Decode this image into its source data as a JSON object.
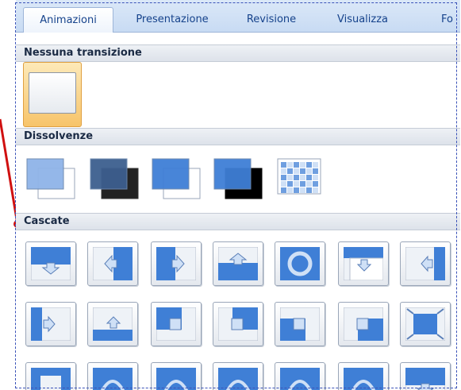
{
  "tabs": [
    {
      "label": "Animazioni",
      "active": true
    },
    {
      "label": "Presentazione",
      "active": false
    },
    {
      "label": "Revisione",
      "active": false
    },
    {
      "label": "Visualizza",
      "active": false
    },
    {
      "label": "Fo",
      "active": false
    }
  ],
  "sections": {
    "none": "Nessuna transizione",
    "fades": "Dissolvenze",
    "wipes": "Cascate"
  },
  "colors": {
    "tab_text": "#15428b",
    "selected_highlight": "#f7c46a",
    "annotation": "#d01010",
    "slide_blue": "#3f7fd6"
  }
}
